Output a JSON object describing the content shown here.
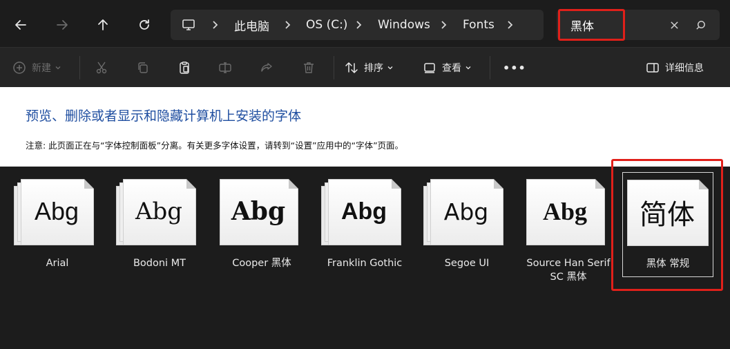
{
  "address_bar": {
    "breadcrumbs": [
      "此电脑",
      "OS (C:)",
      "Windows",
      "Fonts"
    ],
    "search_value": "黑体"
  },
  "command_bar": {
    "new_label": "新建",
    "sort_label": "排序",
    "view_label": "查看",
    "more_label": "•••",
    "details_label": "详细信息"
  },
  "header": {
    "title": "预览、删除或者显示和隐藏计算机上安装的字体",
    "note": "注意: 此页面正在与“字体控制面板”分离。有关更多字体设置，请转到“设置”应用中的“字体”页面。"
  },
  "fonts": [
    {
      "name": "Arial",
      "sample": "Abg",
      "stacked": true
    },
    {
      "name": "Bodoni MT",
      "sample": "Abg",
      "stacked": true
    },
    {
      "name": "Cooper 黑体",
      "sample": "Abg",
      "stacked": false
    },
    {
      "name": "Franklin Gothic",
      "sample": "Abg",
      "stacked": true
    },
    {
      "name": "Segoe UI",
      "sample": "Abg",
      "stacked": true
    },
    {
      "name": "Source Han Serif SC 黑体",
      "sample": "Abg",
      "stacked": false
    },
    {
      "name": "黑体 常规",
      "sample": "简体",
      "stacked": false,
      "selected": true
    }
  ],
  "colors": {
    "highlight": "#e0201a",
    "header_title": "#1f4ea0"
  }
}
